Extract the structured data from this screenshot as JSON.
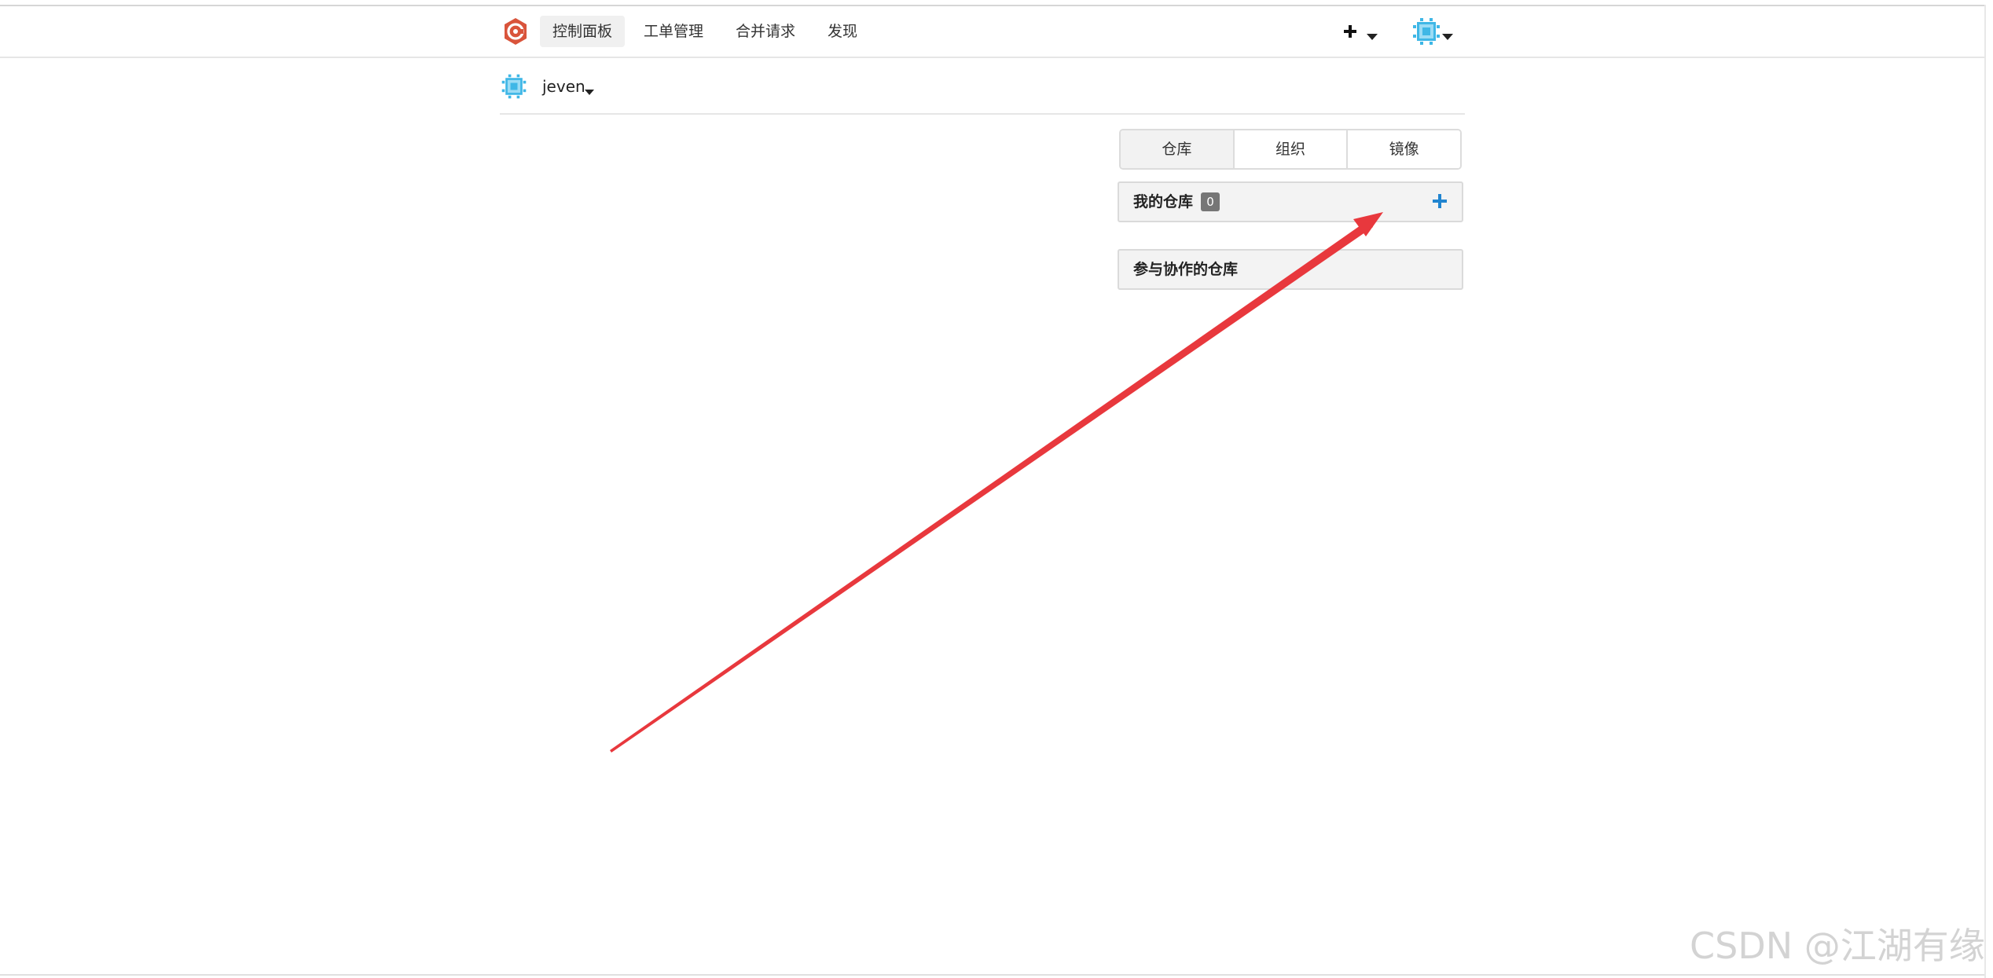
{
  "header": {
    "logo_icon": "gitea-logo-icon",
    "nav": [
      {
        "label": "控制面板",
        "active": true
      },
      {
        "label": "工单管理",
        "active": false
      },
      {
        "label": "合并请求",
        "active": false
      },
      {
        "label": "发现",
        "active": false
      }
    ],
    "create_menu_icon": "plus-icon",
    "user_menu_icon": "avatar-icon"
  },
  "context": {
    "username": "jeven"
  },
  "tabs": [
    {
      "label": "仓库",
      "active": true
    },
    {
      "label": "组织",
      "active": false
    },
    {
      "label": "镜像",
      "active": false
    }
  ],
  "panels": {
    "my_repos": {
      "title": "我的仓库",
      "count": "0",
      "add_icon": "plus-icon"
    },
    "collab_repos": {
      "title": "参与协作的仓库"
    }
  },
  "annotation": {
    "color": "#e8383d"
  },
  "watermark": {
    "text": "CSDN @江湖有缘"
  },
  "colors": {
    "logo": "#d9543b",
    "avatar": "#3fb7e6",
    "accent_blue": "#2185d0"
  }
}
